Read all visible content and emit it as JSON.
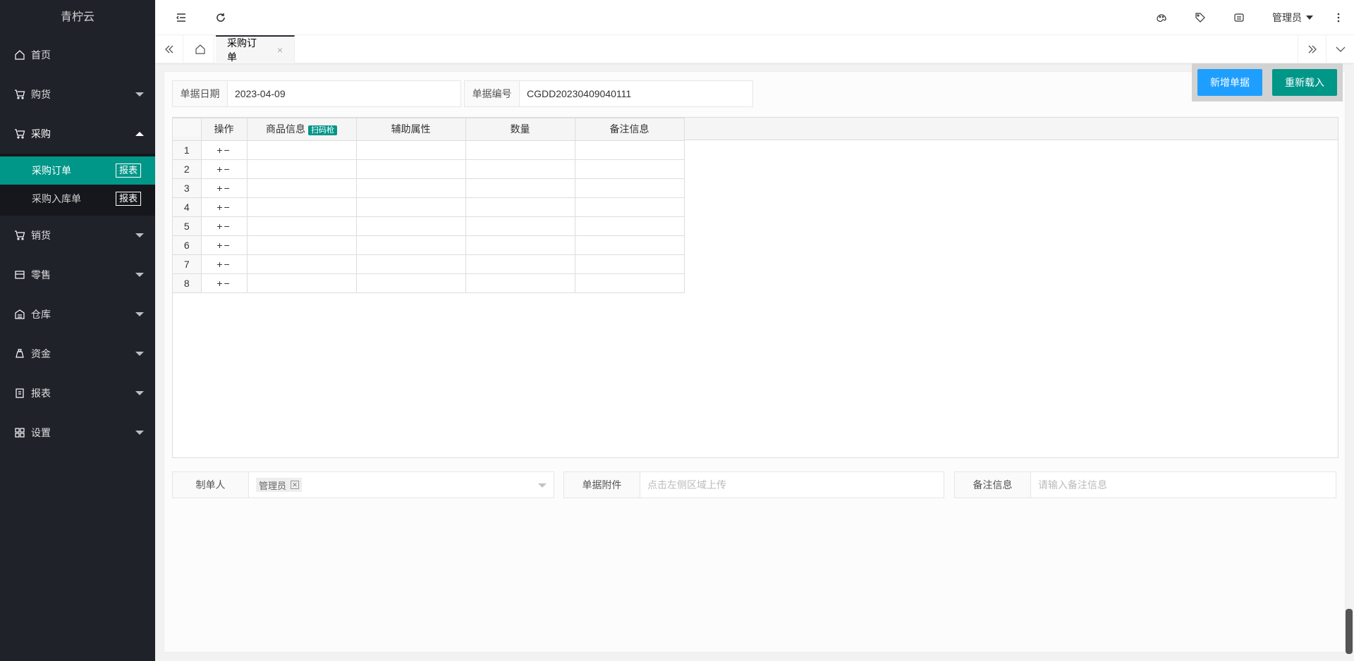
{
  "app": {
    "logo": "青柠云"
  },
  "sidebar": {
    "items": [
      {
        "label": "首页",
        "icon": "home-icon"
      },
      {
        "label": "购货",
        "icon": "cart-icon"
      },
      {
        "label": "采购",
        "icon": "cart-icon"
      },
      {
        "label": "销货",
        "icon": "cart-icon"
      },
      {
        "label": "零售",
        "icon": "store-icon"
      },
      {
        "label": "仓库",
        "icon": "warehouse-icon"
      },
      {
        "label": "资金",
        "icon": "money-bag-icon"
      },
      {
        "label": "报表",
        "icon": "clipboard-icon"
      },
      {
        "label": "设置",
        "icon": "grid-icon"
      }
    ],
    "purchase_sub": [
      {
        "label": "采购订单",
        "tag": "报表"
      },
      {
        "label": "采购入库单",
        "tag": "报表"
      }
    ],
    "active_color": "#009688"
  },
  "header": {
    "user": "管理员"
  },
  "tabs": {
    "active": "采购订单",
    "close": "×"
  },
  "form": {
    "date_label": "单据日期",
    "date_value": "2023-04-09",
    "no_label": "单据编号",
    "no_value": "CGDD20230409040111",
    "new_btn": "新增单据",
    "reload_btn": "重新载入"
  },
  "grid": {
    "columns": [
      "操作",
      "商品信息",
      "辅助属性",
      "数量",
      "备注信息"
    ],
    "scan_tag": "扫码枪",
    "ops": "+−",
    "rows": [
      "1",
      "2",
      "3",
      "4",
      "5",
      "6",
      "7",
      "8"
    ]
  },
  "bottom": {
    "maker_label": "制单人",
    "maker_value": "管理员",
    "attach_label": "单据附件",
    "attach_placeholder": "点击左侧区域上传",
    "remark_label": "备注信息",
    "remark_placeholder": "请输入备注信息"
  }
}
